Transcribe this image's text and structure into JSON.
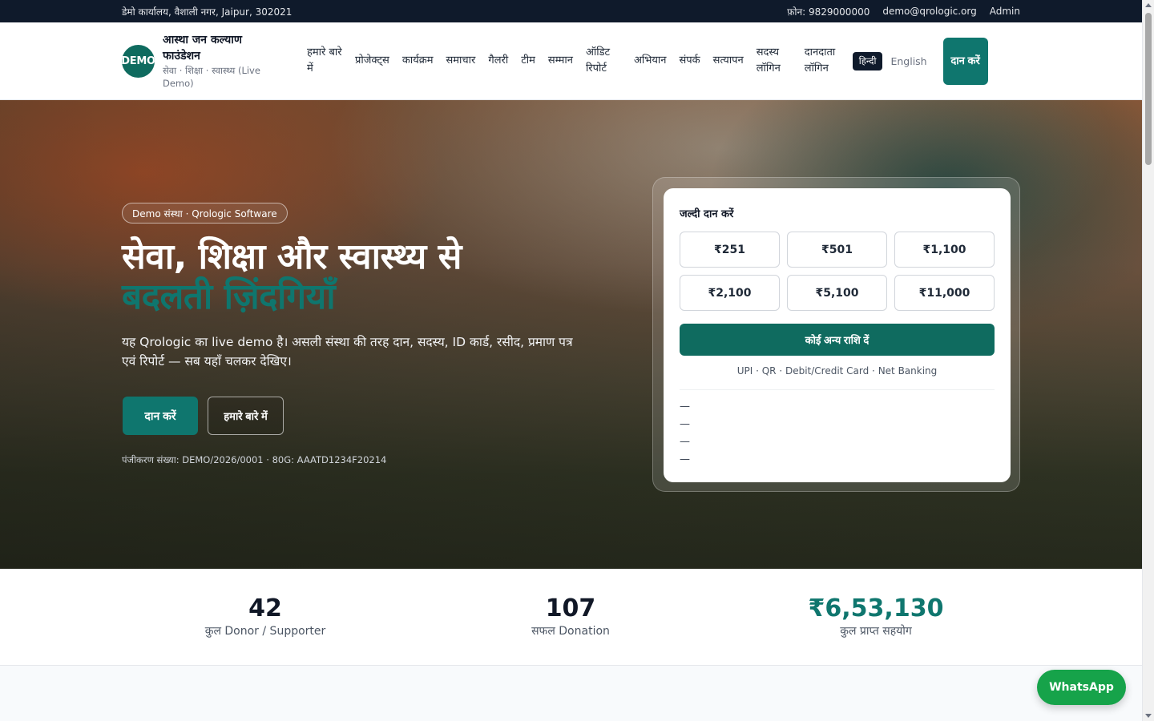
{
  "topbar": {
    "address": "डेमो कार्यालय, वैशाली नगर, Jaipur, 302021",
    "phone": "फ़ोन: 9829000000",
    "email": "demo@qrologic.org",
    "admin": "Admin"
  },
  "header": {
    "logo_text": "DEMO",
    "title": "आस्था जन कल्याण फाउंडेशन",
    "subtitle": "सेवा · शिक्षा · स्वास्थ्य (Live Demo)",
    "nav": [
      "हमारे बारे में",
      "प्रोजेक्ट्स",
      "कार्यक्रम",
      "समाचार",
      "गैलरी",
      "टीम",
      "सम्मान",
      "ऑडिट रिपोर्ट",
      "अभियान",
      "संपर्क",
      "सत्यापन",
      "सदस्य लॉगिन",
      "दानदाता लॉगिन"
    ],
    "lang_hi": "हिन्दी",
    "lang_en": "English",
    "donate": "दान करें"
  },
  "hero": {
    "pill": "Demo संस्था · Qrologic Software",
    "headline_line1": "सेवा, शिक्षा और स्वास्थ्य से",
    "headline_line2": "बदलती ज़िंदगियाँ",
    "lead": "यह Qrologic का live demo है। असली संस्था की तरह दान, सदस्य, ID कार्ड, रसीद, प्रमाण पत्र एवं रिपोर्ट — सब यहाँ चलकर देखिए।",
    "btn_donate": "दान करें",
    "btn_about": "हमारे बारे में",
    "registration": "पंजीकरण संख्या: DEMO/2026/0001 · 80G: AAATD1234F20214"
  },
  "quick_donate": {
    "title": "जल्दी दान करें",
    "amounts": [
      "₹251",
      "₹501",
      "₹1,100",
      "₹2,100",
      "₹5,100",
      "₹11,000"
    ],
    "other_amount": "कोई अन्य राशि दें",
    "payment_methods": "UPI · QR · Debit/Credit Card · Net Banking",
    "placeholders": [
      "—",
      "—",
      "—",
      "—"
    ]
  },
  "stats": [
    {
      "value": "42",
      "label": "कुल Donor / Supporter"
    },
    {
      "value": "107",
      "label": "सफल Donation"
    },
    {
      "value": "₹6,53,130",
      "label": "कुल प्राप्त सहयोग"
    }
  ],
  "whatsapp": "WhatsApp",
  "colors": {
    "primary": "#0f766e",
    "topbar": "#0f1a2b",
    "whatsapp": "#16a34a"
  }
}
